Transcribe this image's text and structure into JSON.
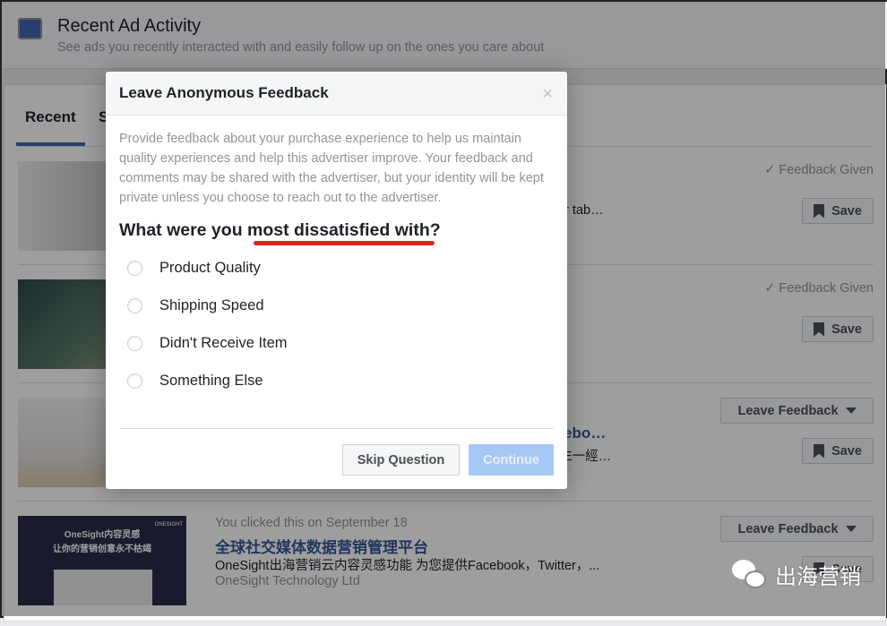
{
  "header": {
    "title": "Recent Ad Activity",
    "subtitle": "See ads you recently interacted with and easily follow up on the ones you care about"
  },
  "tabs": [
    {
      "label": "Recent",
      "active": true
    },
    {
      "label": "S"
    }
  ],
  "rows": [
    {
      "status": "Feedback Given",
      "desc_fragment": "or tab…",
      "save": "Save"
    },
    {
      "status": "Feedback Given",
      "save": "Save"
    },
    {
      "title_fragment": "ebo…",
      "desc_fragment": "E一經…",
      "feedback": "Leave Feedback",
      "save": "Save"
    },
    {
      "meta": "You clicked this on September 18",
      "title": "全球社交媒体数据营销管理平台",
      "desc": "OneSight出海营销云内容灵感功能 为您提供Facebook，Twitter，...",
      "advertiser": "OneSight Technology Ltd",
      "feedback": "Leave Feedback",
      "save": "Save",
      "thumb_text": [
        "OneSight内容灵感",
        "让你的营销创意永不枯竭",
        "ONESIGHT"
      ]
    }
  ],
  "modal": {
    "title": "Leave Anonymous Feedback",
    "close": "×",
    "intro": "Provide feedback about your purchase experience to help us maintain quality experiences and help this advertiser improve. Your feedback and comments may be shared with the advertiser, but your identity will be kept private unless you choose to reach out to the advertiser.",
    "question": "What were you most dissatisfied with?",
    "options": [
      "Product Quality",
      "Shipping Speed",
      "Didn't Receive Item",
      "Something Else"
    ],
    "skip": "Skip Question",
    "continue": "Continue"
  },
  "watermark": "出海营销",
  "colors": {
    "accent": "#4267b2",
    "link": "#365899",
    "underline": "#d9261c",
    "continue_disabled": "#a6c8f5"
  }
}
